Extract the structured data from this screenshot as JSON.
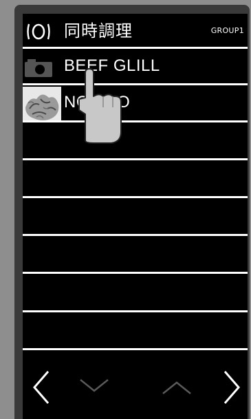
{
  "header": {
    "title": "同時調理",
    "group_label": "GROUP1",
    "icon": "cooking-pot-icon"
  },
  "recipes": [
    {
      "label": "BEEF GLILL",
      "thumbnail": "camera-icon"
    },
    {
      "label": "NOKKIO",
      "thumbnail": "food-photo"
    }
  ],
  "nav": {
    "prev": "chevron-left-icon",
    "scroll_down": "chevron-down-icon",
    "scroll_up": "chevron-up-icon",
    "next": "chevron-right-icon"
  },
  "colors": {
    "screen_bg": "#000000",
    "text": "#ffffff",
    "separator": "#ffffff",
    "dim_arrow": "#5a5a5a",
    "device_frame": "#3a3a3a",
    "hand": "#c8c8c8"
  }
}
